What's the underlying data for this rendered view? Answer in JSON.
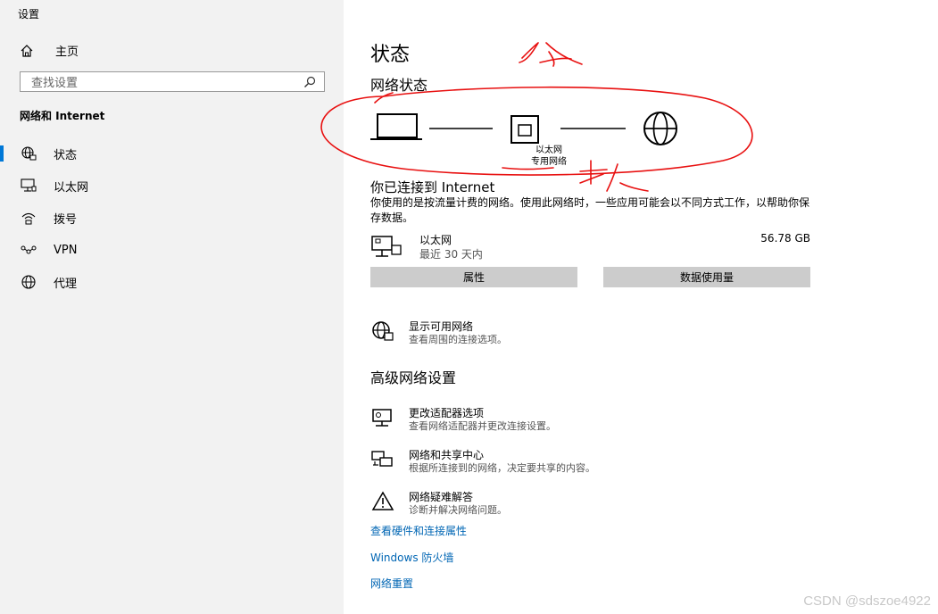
{
  "window": {
    "title": "设置"
  },
  "sidebar": {
    "home_label": "主页",
    "search_placeholder": "查找设置",
    "section_title": "网络和 Internet",
    "items": [
      {
        "label": "状态",
        "icon": "globe-lock-icon",
        "active": true
      },
      {
        "label": "以太网",
        "icon": "ethernet-icon",
        "active": false
      },
      {
        "label": "拨号",
        "icon": "dialup-icon",
        "active": false
      },
      {
        "label": "VPN",
        "icon": "vpn-icon",
        "active": false
      },
      {
        "label": "代理",
        "icon": "globe-icon",
        "active": false
      }
    ]
  },
  "main": {
    "title": "状态",
    "network_status_heading": "网络状态",
    "diagram": {
      "caption_line1": "以太网",
      "caption_line2": "专用网络"
    },
    "connected_title": "你已连接到 Internet",
    "connected_desc": "你使用的是按流量计费的网络。使用此网络时，一些应用可能会以不同方式工作，以帮助你保存数据。",
    "ethernet": {
      "name": "以太网",
      "period": "最近 30 天内",
      "usage": "56.78 GB"
    },
    "buttons": {
      "properties": "属性",
      "data_usage": "数据使用量"
    },
    "show_networks": {
      "title": "显示可用网络",
      "subtitle": "查看周围的连接选项。"
    },
    "advanced_heading": "高级网络设置",
    "advanced": [
      {
        "title": "更改适配器选项",
        "subtitle": "查看网络适配器并更改连接设置。",
        "icon": "adapter-icon"
      },
      {
        "title": "网络和共享中心",
        "subtitle": "根据所连接到的网络，决定要共享的内容。",
        "icon": "sharing-center-icon"
      },
      {
        "title": "网络疑难解答",
        "subtitle": "诊断并解决网络问题。",
        "icon": "warning-icon"
      }
    ],
    "links": {
      "hardware": "查看硬件和连接属性",
      "firewall": "Windows 防火墙",
      "reset": "网络重置"
    }
  },
  "watermark": "CSDN @sdszoe4922",
  "annotation_color": "#e81010"
}
